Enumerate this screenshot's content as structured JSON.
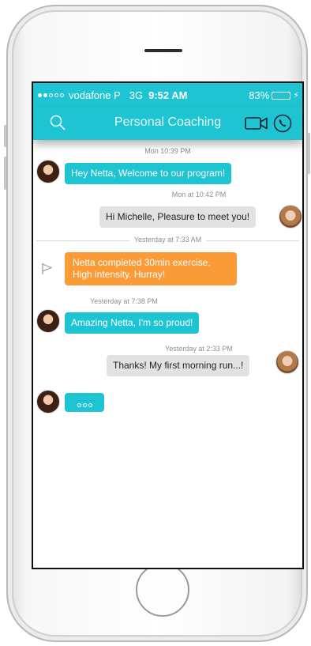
{
  "status_bar": {
    "carrier": "vodafone P",
    "network": "3G",
    "time": "9:52 AM",
    "battery": "83%",
    "battery_level": 0.83
  },
  "nav": {
    "title": "Personal Coaching"
  },
  "messages": {
    "ts1": "Mon 10:39 PM",
    "m1": "Hey Netta, Welcome to our program!",
    "ts2": "Mon at 10:42 PM",
    "m2": "Hi Michelle, Pleasure to meet you!",
    "divider": "Yesterday at 7:33 AM",
    "m3": "Netta completed 30min exercise, High intensity. Hurray!",
    "ts3": "Yesterday at 7:38 PM",
    "m4": "Amazing Netta, I'm so proud!",
    "ts4": "Yesterday at 2:33 PM",
    "m5": "Thanks! My first morning run...!"
  },
  "colors": {
    "accent": "#1ec4d2",
    "system": "#fb9b37",
    "outgoing": "#e2e2e2"
  }
}
